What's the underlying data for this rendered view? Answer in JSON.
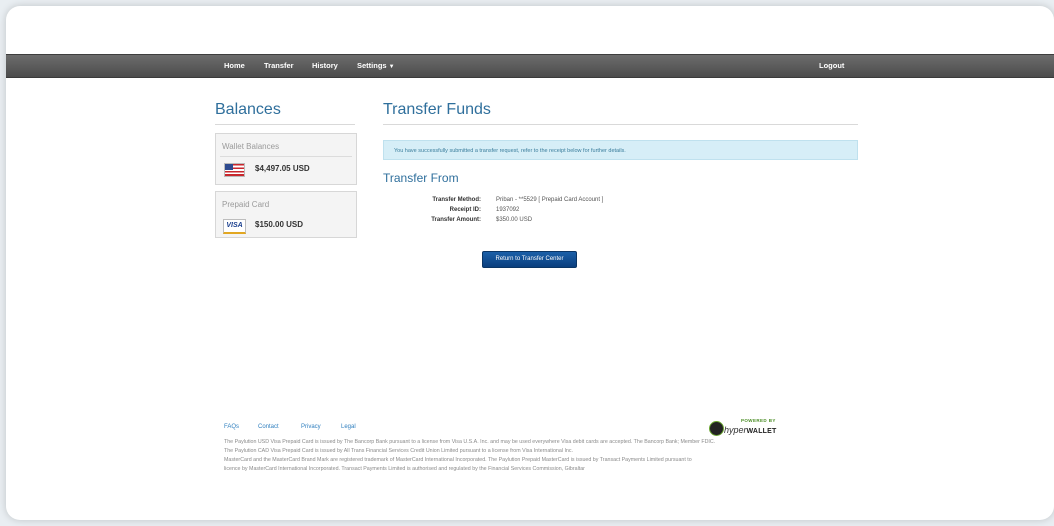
{
  "nav": {
    "items": [
      {
        "label": "Home"
      },
      {
        "label": "Transfer"
      },
      {
        "label": "History"
      },
      {
        "label": "Settings"
      }
    ],
    "logout": "Logout"
  },
  "sidebar": {
    "title": "Balances",
    "wallet": {
      "title": "Wallet Balances",
      "amount": "$4,497.05 USD",
      "icon": "us-flag-icon"
    },
    "prepaid": {
      "title": "Prepaid Card",
      "amount": "$150.00 USD",
      "icon": "visa-card-icon",
      "card_brand": "VISA"
    }
  },
  "main": {
    "title": "Transfer Funds",
    "alert": "You have successfully submitted a transfer request, refer to the receipt below for further details.",
    "section_title": "Transfer From",
    "details": [
      {
        "label": "Transfer Method:",
        "value": "Priban - **5529 [ Prepaid Card Account ]"
      },
      {
        "label": "Receipt ID:",
        "value": "1937092"
      },
      {
        "label": "Transfer Amount:",
        "value": "$350.00 USD"
      }
    ],
    "return_button": "Return to Transfer Center"
  },
  "footer": {
    "links": [
      {
        "label": "FAQs"
      },
      {
        "label": "Contact"
      },
      {
        "label": "Privacy"
      },
      {
        "label": "Legal"
      }
    ],
    "powered_by": "POWERED BY",
    "brand_a": "hyper",
    "brand_b": "WALLET",
    "legal": [
      "The Paylution USD Visa Prepaid Card is issued by The Bancorp Bank pursuant to a license from Visa U.S.A. Inc. and may be used everywhere Visa debit cards are accepted. The Bancorp Bank; Member FDIC.",
      "The Paylution CAD Visa Prepaid Card is issued by All Trans Financial Services Credit Union Limited pursuant to a license from Visa International Inc.",
      "MasterCard and the MasterCard Brand Mark are registered trademark of MasterCard International Incorporated. The Paylution Prepaid MasterCard is issued by Transact Payments Limited pursuant to",
      "licence by MasterCard International Incorporated. Transact Payments Limited is authorised and regulated by the Financial Services Commission, Gibraltar"
    ]
  },
  "colors": {
    "accent": "#2f6f9c",
    "navbar": "#5a5a5a",
    "alert_bg": "#d6eef7",
    "button": "#0f4d92",
    "link": "#2f7fbf"
  }
}
